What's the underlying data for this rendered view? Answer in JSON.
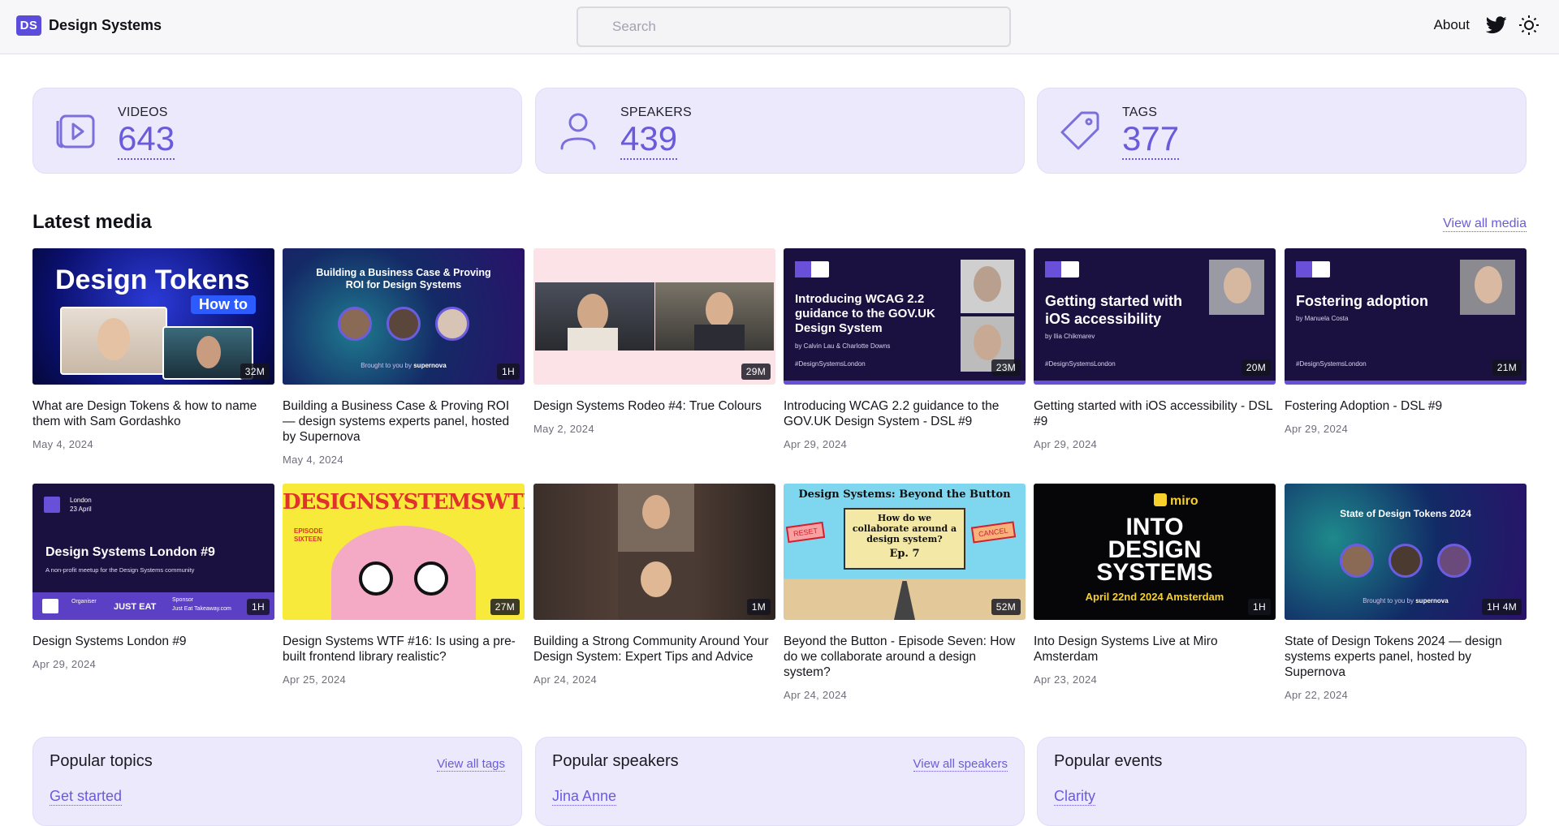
{
  "header": {
    "brand_mark": "DS",
    "brand_name": "Design Systems",
    "search_placeholder": "Search",
    "about_label": "About",
    "icons": [
      "twitter-icon",
      "theme-toggle-icon"
    ]
  },
  "stats": [
    {
      "label": "VIDEOS",
      "value": "643",
      "icon": "video-icon"
    },
    {
      "label": "SPEAKERS",
      "value": "439",
      "icon": "person-icon"
    },
    {
      "label": "TAGS",
      "value": "377",
      "icon": "tag-icon"
    }
  ],
  "latest": {
    "title": "Latest media",
    "view_all_label": "View all media",
    "items": [
      {
        "title": "What are Design Tokens & how to name them with Sam Gordashko",
        "date": "May 4, 2024",
        "duration": "32M",
        "thumb_text": [
          "Design Tokens",
          "How to"
        ]
      },
      {
        "title": "Building a Business Case & Proving ROI — design systems experts panel, hosted by Supernova",
        "date": "May 4, 2024",
        "duration": "1H",
        "thumb_text": [
          "Building a Business Case & Proving",
          "ROI for Design Systems",
          "Brought to you by",
          "supernova"
        ]
      },
      {
        "title": "Design Systems Rodeo #4: True Colours",
        "date": "May 2, 2024",
        "duration": "29M",
        "thumb_text": []
      },
      {
        "title": "Introducing WCAG 2.2 guidance to the GOV.UK Design System - DSL #9",
        "date": "Apr 29, 2024",
        "duration": "23M",
        "thumb_text": [
          "Introducing WCAG 2.2 guidance to the GOV.UK Design System",
          "by Calvin Lau & Charlotte Downs",
          "#DesignSystemsLondon"
        ]
      },
      {
        "title": "Getting started with iOS accessibility - DSL #9",
        "date": "Apr 29, 2024",
        "duration": "20M",
        "thumb_text": [
          "Getting started with iOS accessibility",
          "by Ilia Chikmarev",
          "#DesignSystemsLondon"
        ]
      },
      {
        "title": "Fostering Adoption - DSL #9",
        "date": "Apr 29, 2024",
        "duration": "21M",
        "thumb_text": [
          "Fostering adoption",
          "by Manuela Costa",
          "#DesignSystemsLondon"
        ]
      },
      {
        "title": "Design Systems London #9",
        "date": "Apr 29, 2024",
        "duration": "1H",
        "thumb_text": [
          "London",
          "23 April",
          "Design Systems London #9",
          "A non-profit meetup for the Design Systems community",
          "Organiser",
          "JUST EAT",
          "Sponsor",
          "Just Eat Takeaway.com"
        ]
      },
      {
        "title": "Design Systems WTF #16: Is using a pre-built frontend library realistic?",
        "date": "Apr 25, 2024",
        "duration": "27M",
        "thumb_text": [
          "DESIGNSYSTEMSWTF",
          "EPISODE",
          "SIXTEEN"
        ]
      },
      {
        "title": "Building a Strong Community Around Your Design System: Expert Tips and Advice",
        "date": "Apr 24, 2024",
        "duration": "1M",
        "thumb_text": []
      },
      {
        "title": "Beyond the Button - Episode Seven: How do we collaborate around a design system?",
        "date": "Apr 24, 2024",
        "duration": "52M",
        "thumb_text": [
          "Design Systems: Beyond the Button",
          "How do we collaborate around a design system?",
          "Ep. 7",
          "RESET",
          "CANCEL"
        ]
      },
      {
        "title": "Into Design Systems Live at Miro Amsterdam",
        "date": "Apr 23, 2024",
        "duration": "1H",
        "thumb_text": [
          "miro",
          "INTO",
          "DESIGN",
          "SYSTEMS",
          "April 22nd 2024 Amsterdam"
        ]
      },
      {
        "title": "State of Design Tokens 2024 — design systems experts panel, hosted by Supernova",
        "date": "Apr 22, 2024",
        "duration": "1H 4M",
        "thumb_text": [
          "State of Design Tokens 2024",
          "Brought to you by",
          "supernova"
        ]
      }
    ]
  },
  "panels": [
    {
      "title": "Popular topics",
      "link": "View all tags",
      "first_item": "Get started"
    },
    {
      "title": "Popular speakers",
      "link": "View all speakers",
      "first_item": "Jina Anne"
    },
    {
      "title": "Popular events",
      "link": "",
      "first_item": "Clarity"
    }
  ],
  "colors": {
    "accent": "#6a5bdb",
    "card_bg": "#ece9fc",
    "brand": "#5b4cdb"
  }
}
